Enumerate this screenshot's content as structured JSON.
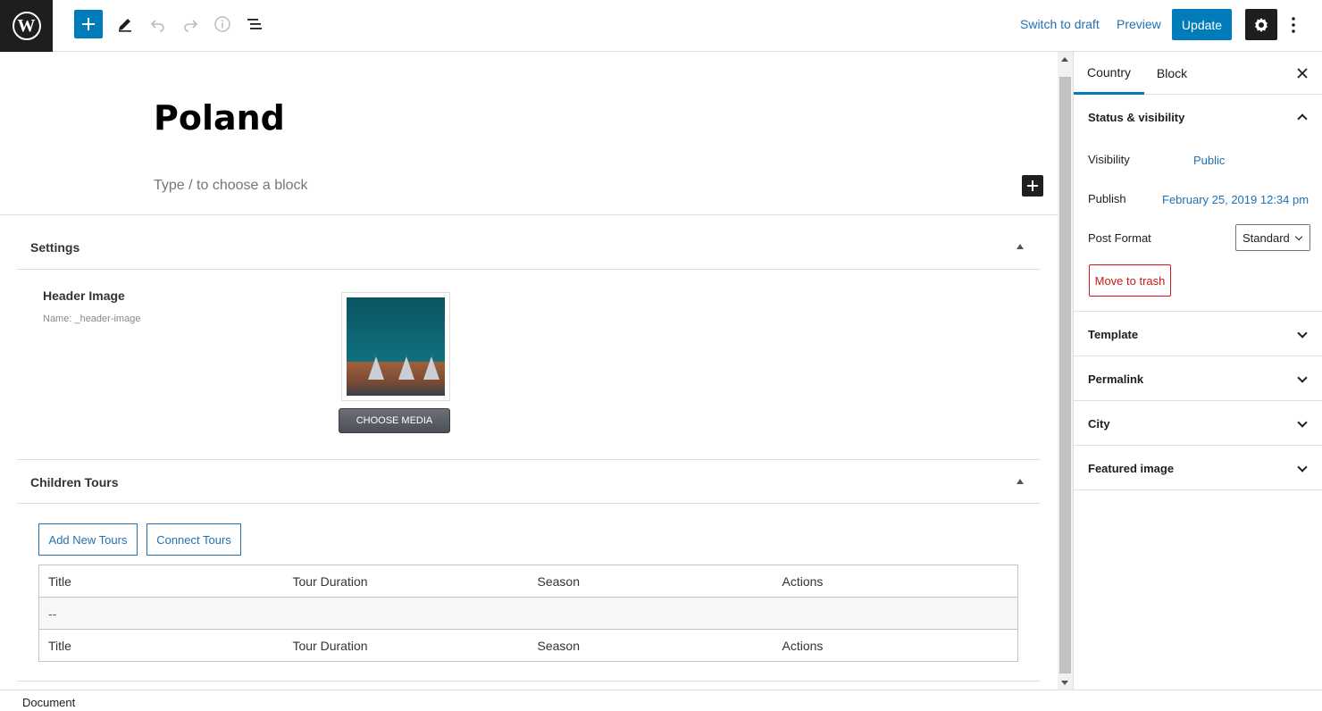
{
  "topbar": {
    "add_block_icon": "plus-icon",
    "tools_icon": "pencil-icon",
    "undo_icon": "undo-icon",
    "redo_icon": "redo-icon",
    "info_icon": "info-icon",
    "list_view_icon": "list-view-icon",
    "switch_to_draft": "Switch to draft",
    "preview": "Preview",
    "update": "Update",
    "settings_icon": "gear-icon",
    "more_icon": "kebab-icon"
  },
  "post": {
    "title": "Poland",
    "block_placeholder": "Type / to choose a block"
  },
  "settings_box": {
    "title": "Settings",
    "field_label": "Header Image",
    "field_name": "Name: _header-image",
    "choose_media": "CHOOSE MEDIA"
  },
  "children_tours": {
    "title": "Children Tours",
    "add_new": "Add New Tours",
    "connect": "Connect Tours",
    "columns": [
      "Title",
      "Tour Duration",
      "Season",
      "Actions"
    ],
    "empty_row": "--",
    "footer_columns": [
      "Title",
      "Tour Duration",
      "Season",
      "Actions"
    ]
  },
  "sidebar": {
    "tabs": [
      "Country",
      "Block"
    ],
    "status_visibility": {
      "title": "Status & visibility",
      "visibility_label": "Visibility",
      "visibility_value": "Public",
      "publish_label": "Publish",
      "publish_value": "February 25, 2019 12:34 pm",
      "post_format_label": "Post Format",
      "post_format_value": "Standard",
      "move_to_trash": "Move to trash"
    },
    "panels": [
      "Template",
      "Permalink",
      "City",
      "Featured image"
    ]
  },
  "footer": {
    "breadcrumb": "Document"
  },
  "colors": {
    "accent": "#007cba",
    "link": "#2271b1",
    "danger": "#cc1818",
    "dark": "#1e1e1e"
  }
}
